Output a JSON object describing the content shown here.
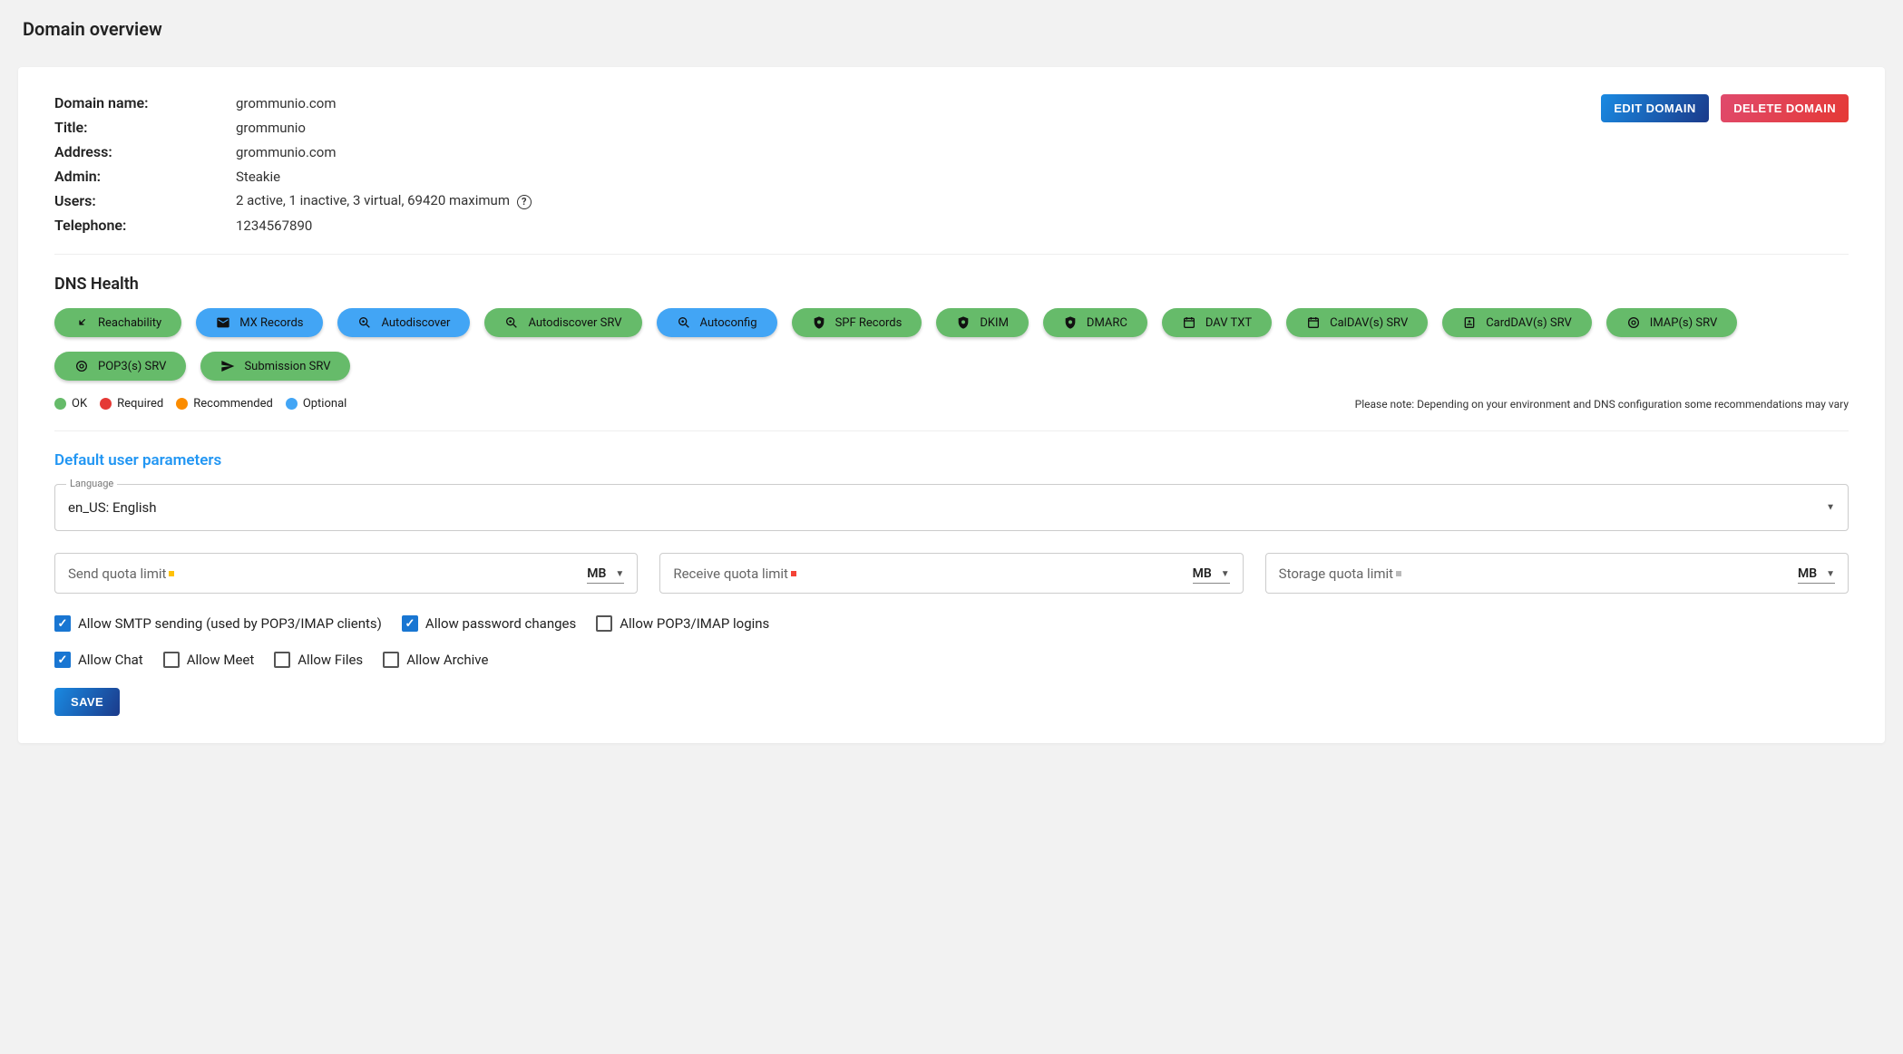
{
  "page_title": "Domain overview",
  "actions": {
    "edit": "EDIT DOMAIN",
    "delete": "DELETE DOMAIN",
    "save": "SAVE"
  },
  "details": {
    "domain_name_label": "Domain name:",
    "domain_name": "grommunio.com",
    "title_label": "Title:",
    "title": "grommunio",
    "address_label": "Address:",
    "address": "grommunio.com",
    "admin_label": "Admin:",
    "admin": "Steakie",
    "users_label": "Users:",
    "users": "2 active, 1 inactive, 3 virtual, 69420 maximum",
    "telephone_label": "Telephone:",
    "telephone": "1234567890"
  },
  "dns": {
    "title": "DNS Health",
    "chips": [
      {
        "label": "Reachability",
        "color": "green",
        "icon": "arrow-in"
      },
      {
        "label": "MX Records",
        "color": "blue",
        "icon": "mail"
      },
      {
        "label": "Autodiscover",
        "color": "blue",
        "icon": "magnify-at"
      },
      {
        "label": "Autodiscover SRV",
        "color": "green",
        "icon": "magnify-at"
      },
      {
        "label": "Autoconfig",
        "color": "blue",
        "icon": "magnify-at"
      },
      {
        "label": "SPF Records",
        "color": "green",
        "icon": "shield"
      },
      {
        "label": "DKIM",
        "color": "green",
        "icon": "shield"
      },
      {
        "label": "DMARC",
        "color": "green",
        "icon": "shield"
      },
      {
        "label": "DAV TXT",
        "color": "green",
        "icon": "calendar"
      },
      {
        "label": "CalDAV(s) SRV",
        "color": "green",
        "icon": "calendar"
      },
      {
        "label": "CardDAV(s) SRV",
        "color": "green",
        "icon": "contact"
      },
      {
        "label": "IMAP(s) SRV",
        "color": "green",
        "icon": "at"
      },
      {
        "label": "POP3(s) SRV",
        "color": "green",
        "icon": "at"
      },
      {
        "label": "Submission SRV",
        "color": "green",
        "icon": "send"
      }
    ],
    "legend": {
      "ok": "OK",
      "required": "Required",
      "recommended": "Recommended",
      "optional": "Optional"
    },
    "note": "Please note: Depending on your environment and DNS configuration some recommendations may vary"
  },
  "defaults": {
    "title": "Default user parameters",
    "language_label": "Language",
    "language_value": "en_US: English",
    "quotas": [
      {
        "label": "Send quota limit",
        "marker": "yellow",
        "unit": "MB"
      },
      {
        "label": "Receive quota limit",
        "marker": "red",
        "unit": "MB"
      },
      {
        "label": "Storage quota limit",
        "marker": "gray",
        "unit": "MB"
      }
    ],
    "checks_row1": [
      {
        "label": "Allow SMTP sending (used by POP3/IMAP clients)",
        "checked": true
      },
      {
        "label": "Allow password changes",
        "checked": true
      },
      {
        "label": "Allow POP3/IMAP logins",
        "checked": false
      }
    ],
    "checks_row2": [
      {
        "label": "Allow Chat",
        "checked": true
      },
      {
        "label": "Allow Meet",
        "checked": false
      },
      {
        "label": "Allow Files",
        "checked": false
      },
      {
        "label": "Allow Archive",
        "checked": false
      }
    ]
  }
}
